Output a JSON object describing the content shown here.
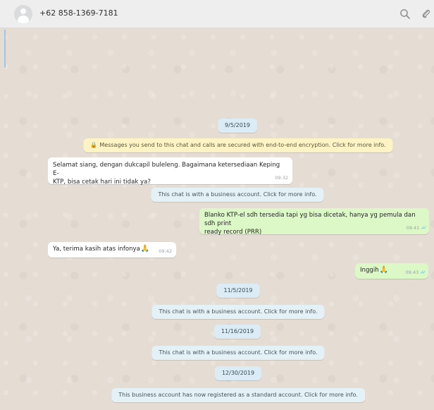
{
  "header": {
    "contact": "+62 858-1369-7181",
    "icons": [
      "search-icon",
      "attach-icon"
    ]
  },
  "messages": {
    "date1": "9/5/2019",
    "encryption": "Messages you send to this chat and calls are secured with end-to-end encryption. Click for more info.",
    "incoming1": {
      "line1": "Selamat siang, dengan dukcapil buleleng. Bagaimana ketersediaan Keping E-",
      "line2": "KTP, bisa cetak hari ini tidak ya?",
      "time": "09:32"
    },
    "business1": "This chat is with a business account. Click for more info.",
    "outgoing1": {
      "line1": "Blanko KTP-el sdh tersedia tapi yg bisa dicetak, hanya yg pemula dan sdh print",
      "line2": "ready record (PRR)",
      "time": "09:41"
    },
    "incoming2": {
      "text": "Ya, terima kasih atas infonya",
      "emoji": "🙏",
      "time": "09:42"
    },
    "outgoing2": {
      "text": "Inggih",
      "emoji": "🙏",
      "time": "09:43"
    },
    "date2": "11/5/2019",
    "business2": "This chat is with a business account. Click for more info.",
    "date3": "11/16/2019",
    "business3": "This chat is with a business account. Click for more info.",
    "date4": "12/30/2019",
    "standard": "This business account has now registered as a standard account. Click for more info."
  },
  "colors": {
    "background": "#e5ddd4",
    "incoming": "#ffffff",
    "outgoing": "#dcf8c6",
    "system": "#fdf3c4",
    "date": "#dcecf7",
    "ticks": "#4fc3f7"
  }
}
